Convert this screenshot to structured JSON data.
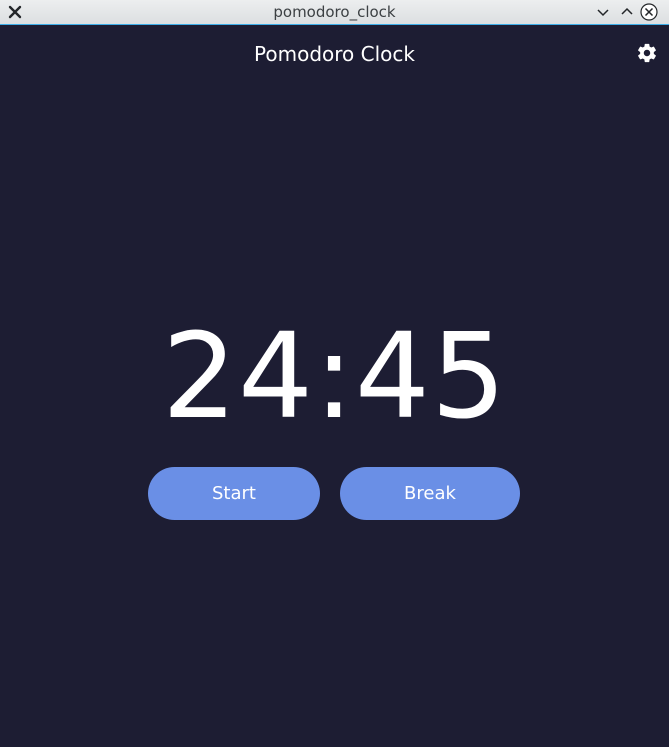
{
  "window": {
    "title": "pomodoro_clock",
    "accent": "#3daee9"
  },
  "app": {
    "title": "Pomodoro Clock",
    "background": "#1d1d33",
    "button_color": "#6a8fe6"
  },
  "timer": {
    "display": "24:45"
  },
  "controls": {
    "start_label": "Start",
    "break_label": "Break"
  },
  "icons": {
    "settings": "gear-icon",
    "window_close_left": "close-icon",
    "window_minimize": "chevron-down-icon",
    "window_maximize": "chevron-up-icon",
    "window_close": "circle-close-icon"
  }
}
